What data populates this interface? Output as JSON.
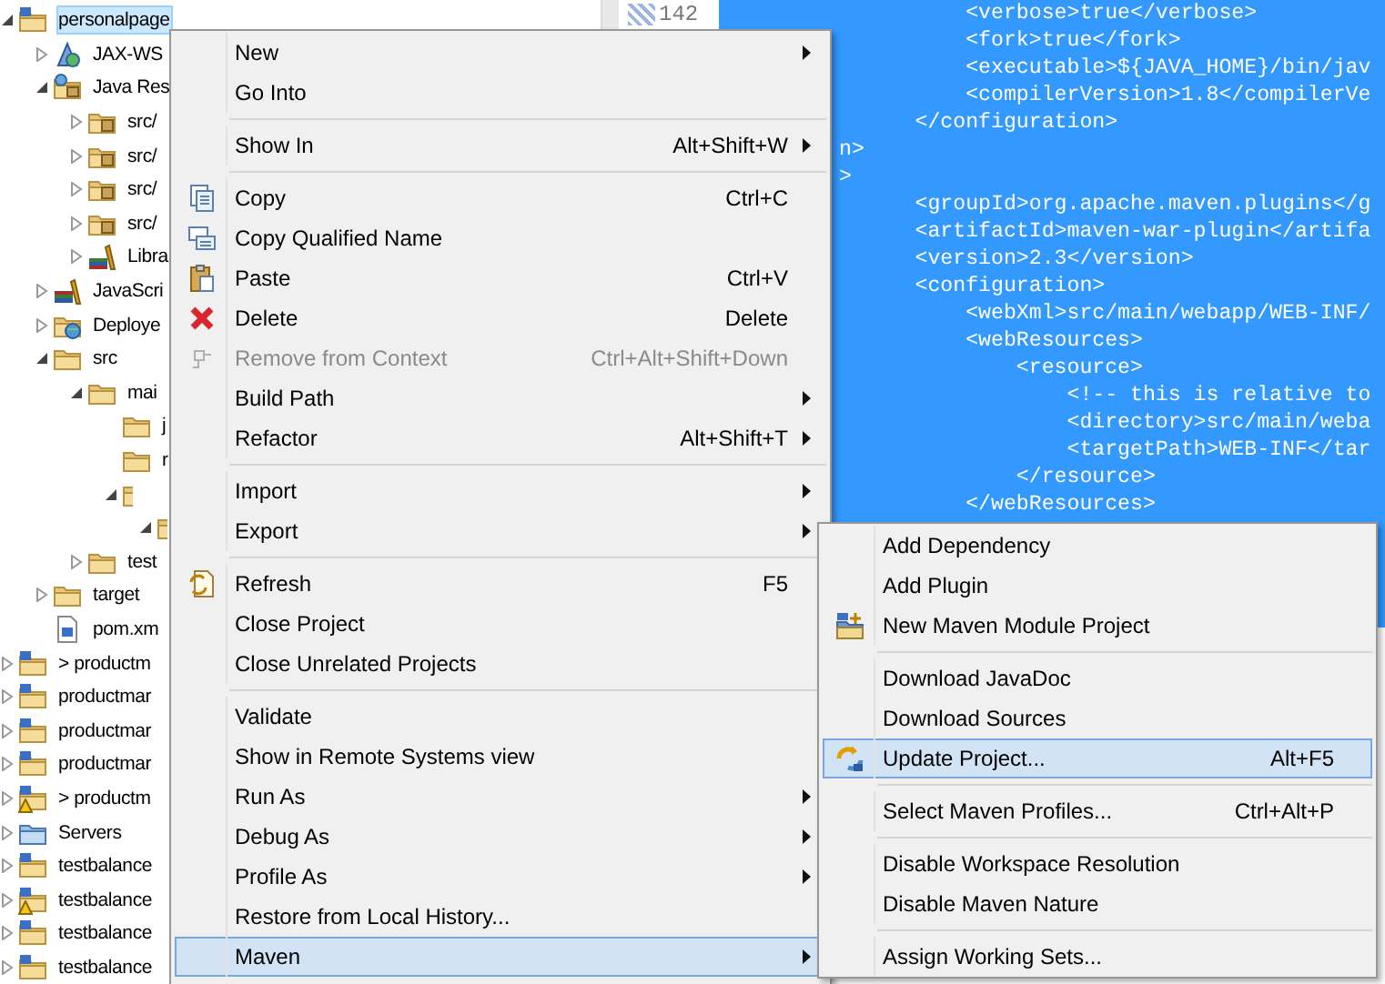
{
  "project_explorer": {
    "tree": [
      {
        "label": "personalpage",
        "kind": "project",
        "expandable": true,
        "expanded": true,
        "selected": true,
        "warning": false,
        "children": [
          {
            "label": "JAX-WS",
            "kind": "webservice",
            "expandable": true,
            "expanded": false,
            "selected": false,
            "warning": false
          },
          {
            "label": "Java Res",
            "kind": "java-resources",
            "expandable": true,
            "expanded": true,
            "selected": false,
            "warning": false,
            "children": [
              {
                "label": "src/",
                "kind": "package-root",
                "expandable": true,
                "expanded": false,
                "selected": false,
                "warning": false
              },
              {
                "label": "src/",
                "kind": "package-root",
                "expandable": true,
                "expanded": false,
                "selected": false,
                "warning": false
              },
              {
                "label": "src/",
                "kind": "package-root",
                "expandable": true,
                "expanded": false,
                "selected": false,
                "warning": false
              },
              {
                "label": "src/",
                "kind": "package-root",
                "expandable": true,
                "expanded": false,
                "selected": false,
                "warning": false
              },
              {
                "label": "Libra",
                "kind": "library",
                "expandable": true,
                "expanded": false,
                "selected": false,
                "warning": false
              }
            ]
          },
          {
            "label": "JavaScri",
            "kind": "javascript",
            "expandable": true,
            "expanded": false,
            "selected": false,
            "warning": false
          },
          {
            "label": "Deploye",
            "kind": "deployed",
            "expandable": true,
            "expanded": false,
            "selected": false,
            "warning": false
          },
          {
            "label": "src",
            "kind": "folder",
            "expandable": true,
            "expanded": true,
            "selected": false,
            "warning": false,
            "children": [
              {
                "label": "mai",
                "kind": "folder",
                "expandable": true,
                "expanded": true,
                "selected": false,
                "warning": false,
                "children": [
                  {
                    "label": "j",
                    "kind": "folder",
                    "expandable": false,
                    "selected": false,
                    "warning": false
                  },
                  {
                    "label": "r",
                    "kind": "folder",
                    "expandable": false,
                    "selected": false,
                    "warning": false
                  },
                  {
                    "kind": "folder",
                    "expandable": true,
                    "expanded": true,
                    "warning": false,
                    "children": [
                      {
                        "kind": "folder",
                        "expandable": true,
                        "expanded": true,
                        "warning": false
                      }
                    ]
                  }
                ]
              },
              {
                "label": "test",
                "kind": "folder",
                "expandable": true,
                "expanded": false,
                "selected": false,
                "warning": false
              }
            ]
          },
          {
            "label": "target",
            "kind": "folder",
            "expandable": true,
            "expanded": false,
            "selected": false,
            "warning": false
          },
          {
            "label": "pom.xm",
            "kind": "file",
            "expandable": false,
            "selected": false,
            "warning": false
          }
        ]
      },
      {
        "label": "> productm",
        "kind": "project",
        "expandable": true,
        "expanded": false,
        "selected": false,
        "warning": false
      },
      {
        "label": "productmar",
        "kind": "project",
        "expandable": true,
        "expanded": false,
        "selected": false,
        "warning": false
      },
      {
        "label": "productmar",
        "kind": "project",
        "expandable": true,
        "expanded": false,
        "selected": false,
        "warning": false
      },
      {
        "label": "productmar",
        "kind": "project",
        "expandable": true,
        "expanded": false,
        "selected": false,
        "warning": false
      },
      {
        "label": "> productm",
        "kind": "project",
        "expandable": true,
        "expanded": false,
        "selected": false,
        "warning": true
      },
      {
        "label": "Servers",
        "kind": "servers",
        "expandable": true,
        "expanded": false,
        "selected": false,
        "warning": false
      },
      {
        "label": "testbalance",
        "kind": "project",
        "expandable": true,
        "expanded": false,
        "selected": false,
        "warning": false
      },
      {
        "label": "testbalance",
        "kind": "project",
        "expandable": true,
        "expanded": false,
        "selected": false,
        "warning": true
      },
      {
        "label": "testbalance",
        "kind": "project",
        "expandable": true,
        "expanded": false,
        "selected": false,
        "warning": false
      },
      {
        "label": "testbalance",
        "kind": "project",
        "expandable": true,
        "expanded": false,
        "selected": false,
        "warning": false
      }
    ]
  },
  "editor": {
    "line_number": "142",
    "code_lines": [
      "          <verbose>true</verbose>",
      "          <fork>true</fork>",
      "          <executable>${JAVA_HOME}/bin/jav",
      "          <compilerVersion>1.8</compilerVe",
      "      </configuration>",
      "n>",
      ">",
      "      <groupId>org.apache.maven.plugins</g",
      "      <artifactId>maven-war-plugin</artifa",
      "      <version>2.3</version>",
      "      <configuration>",
      "          <webXml>src/main/webapp/WEB-INF/",
      "          <webResources>",
      "              <resource>",
      "                  <!-- this is relative to",
      "                  <directory>src/main/weba",
      "                  <targetPath>WEB-INF</tar",
      "              </resource>",
      "          </webResources>"
    ]
  },
  "context_menu": {
    "groups": [
      [
        {
          "label": "New",
          "submenu": true,
          "disabled": false,
          "selected": false
        },
        {
          "label": "Go Into",
          "submenu": false,
          "disabled": false,
          "selected": false
        }
      ],
      [
        {
          "label": "Show In",
          "shortcut": "Alt+Shift+W",
          "submenu": true,
          "disabled": false,
          "selected": false
        }
      ],
      [
        {
          "label": "Copy",
          "shortcut": "Ctrl+C",
          "submenu": false,
          "disabled": false,
          "selected": false
        },
        {
          "label": "Copy Qualified Name",
          "submenu": false,
          "disabled": false,
          "selected": false
        },
        {
          "label": "Paste",
          "shortcut": "Ctrl+V",
          "submenu": false,
          "disabled": false,
          "selected": false
        },
        {
          "label": "Delete",
          "shortcut": "Delete",
          "submenu": false,
          "disabled": false,
          "selected": false
        },
        {
          "label": "Remove from Context",
          "shortcut": "Ctrl+Alt+Shift+Down",
          "submenu": false,
          "disabled": true,
          "selected": false
        },
        {
          "label": "Build Path",
          "submenu": true,
          "disabled": false,
          "selected": false
        },
        {
          "label": "Refactor",
          "shortcut": "Alt+Shift+T",
          "submenu": true,
          "disabled": false,
          "selected": false
        }
      ],
      [
        {
          "label": "Import",
          "submenu": true,
          "disabled": false,
          "selected": false
        },
        {
          "label": "Export",
          "submenu": true,
          "disabled": false,
          "selected": false
        }
      ],
      [
        {
          "label": "Refresh",
          "shortcut": "F5",
          "submenu": false,
          "disabled": false,
          "selected": false
        },
        {
          "label": "Close Project",
          "submenu": false,
          "disabled": false,
          "selected": false
        },
        {
          "label": "Close Unrelated Projects",
          "submenu": false,
          "disabled": false,
          "selected": false
        }
      ],
      [
        {
          "label": "Validate",
          "submenu": false,
          "disabled": false,
          "selected": false
        },
        {
          "label": "Show in Remote Systems view",
          "submenu": false,
          "disabled": false,
          "selected": false
        },
        {
          "label": "Run As",
          "submenu": true,
          "disabled": false,
          "selected": false
        },
        {
          "label": "Debug As",
          "submenu": true,
          "disabled": false,
          "selected": false
        },
        {
          "label": "Profile As",
          "submenu": true,
          "disabled": false,
          "selected": false
        },
        {
          "label": "Restore from Local History...",
          "submenu": false,
          "disabled": false,
          "selected": false
        },
        {
          "label": "Maven",
          "submenu": true,
          "disabled": false,
          "selected": true
        }
      ]
    ]
  },
  "maven_submenu": {
    "groups": [
      [
        {
          "label": "Add Dependency",
          "submenu": false,
          "disabled": false,
          "selected": false
        },
        {
          "label": "Add Plugin",
          "submenu": false,
          "disabled": false,
          "selected": false
        },
        {
          "label": "New Maven Module Project",
          "submenu": false,
          "disabled": false,
          "selected": false
        }
      ],
      [
        {
          "label": "Download JavaDoc",
          "submenu": false,
          "disabled": false,
          "selected": false
        },
        {
          "label": "Download Sources",
          "submenu": false,
          "disabled": false,
          "selected": false
        },
        {
          "label": "Update Project...",
          "shortcut": "Alt+F5",
          "submenu": false,
          "disabled": false,
          "selected": true
        }
      ],
      [
        {
          "label": "Select Maven Profiles...",
          "shortcut": "Ctrl+Alt+P",
          "submenu": false,
          "disabled": false,
          "selected": false
        }
      ],
      [
        {
          "label": "Disable Workspace Resolution",
          "submenu": false,
          "disabled": false,
          "selected": false
        },
        {
          "label": "Disable Maven Nature",
          "submenu": false,
          "disabled": false,
          "selected": false
        }
      ],
      [
        {
          "label": "Assign Working Sets...",
          "submenu": false,
          "disabled": false,
          "selected": false
        }
      ]
    ]
  }
}
